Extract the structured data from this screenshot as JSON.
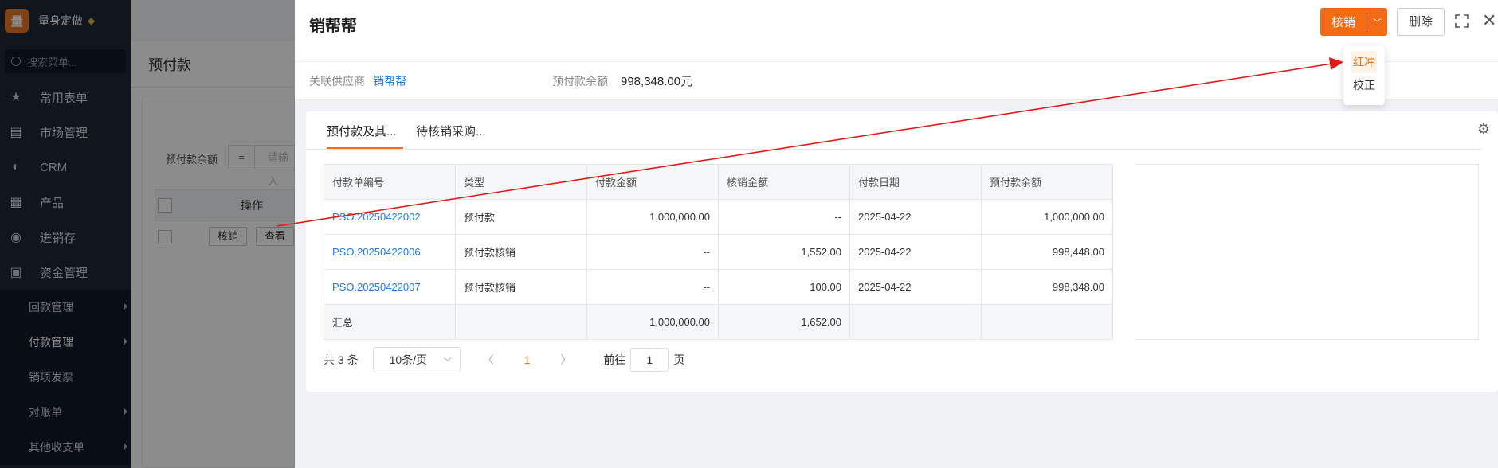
{
  "sidebar": {
    "logo_char": "量",
    "brand": "量身定做",
    "search_placeholder": "搜索菜单...",
    "items": [
      {
        "label": "常用表单"
      },
      {
        "label": "市场管理"
      },
      {
        "label": "CRM"
      },
      {
        "label": "产品"
      },
      {
        "label": "进销存"
      },
      {
        "label": "资金管理"
      }
    ],
    "subitems": [
      {
        "label": "回款管理"
      },
      {
        "label": "付款管理"
      },
      {
        "label": "销项发票"
      },
      {
        "label": "对账单"
      },
      {
        "label": "其他收支单"
      }
    ]
  },
  "background": {
    "page_title": "预付款",
    "filter_label": "预付款余额",
    "filter_op": "=",
    "filter_placeholder": "请输入",
    "col_op": "操作",
    "btn_writeoff": "核销",
    "btn_view": "查看"
  },
  "drawer": {
    "title": "销帮帮",
    "btn_writeoff": "核销",
    "btn_delete": "删除",
    "dropdown": {
      "item1": "红冲",
      "item2": "校正"
    },
    "info": {
      "supplier_label": "关联供应商",
      "supplier_value": "销帮帮",
      "balance_label": "预付款余额",
      "balance_value": "998,348.00元"
    },
    "tabs": [
      {
        "label": "预付款及其..."
      },
      {
        "label": "待核销采购..."
      }
    ],
    "table": {
      "headers": [
        "付款单编号",
        "类型",
        "付款金额",
        "核销金额",
        "付款日期",
        "预付款余额"
      ],
      "rows": [
        [
          "PSO.20250422002",
          "预付款",
          "1,000,000.00",
          "--",
          "2025-04-22",
          "1,000,000.00"
        ],
        [
          "PSO.20250422006",
          "预付款核销",
          "--",
          "1,552.00",
          "2025-04-22",
          "998,448.00"
        ],
        [
          "PSO.20250422007",
          "预付款核销",
          "--",
          "100.00",
          "2025-04-22",
          "998,348.00"
        ]
      ],
      "summary": [
        "汇总",
        "",
        "1,000,000.00",
        "1,652.00",
        "",
        ""
      ]
    },
    "pager": {
      "total": "共 3 条",
      "page_size": "10条/页",
      "current": "1",
      "goto_label": "前往",
      "goto_value": "1",
      "page_suffix": "页"
    }
  },
  "colors": {
    "accent": "#f26b16",
    "link": "#1f7ae0",
    "sidebar_bg": "#1f2937",
    "arrow": "#e21a1a"
  }
}
